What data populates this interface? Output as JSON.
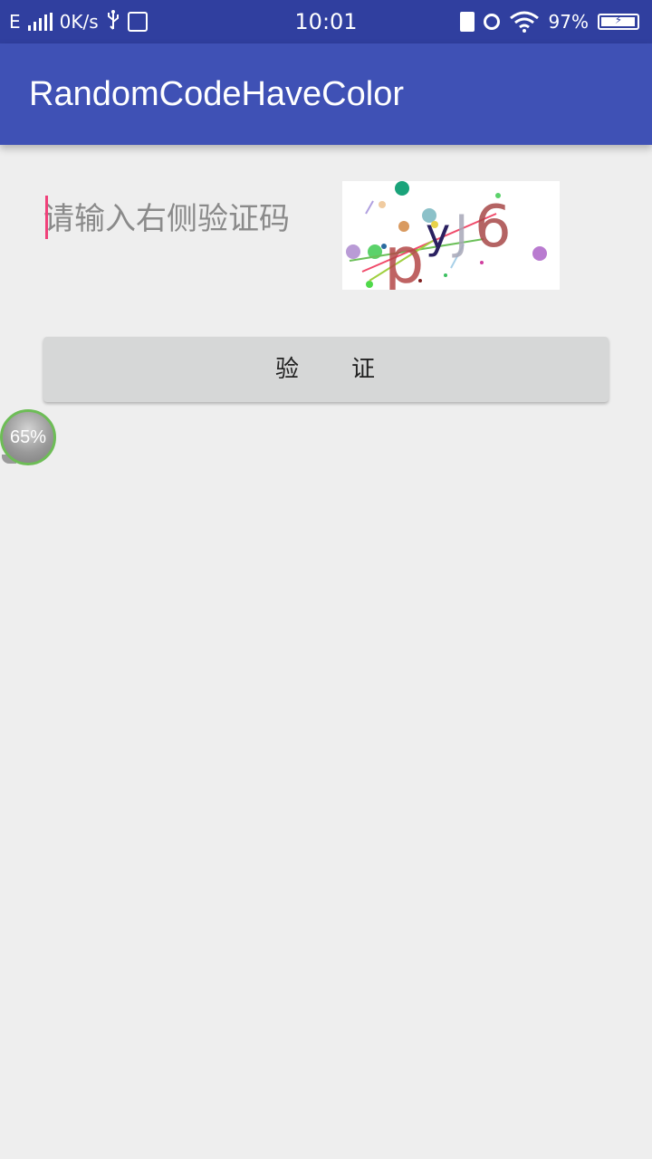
{
  "status_bar": {
    "network_type": "E",
    "speed": "0K/s",
    "time": "10:01",
    "battery_percent": "97%",
    "battery_level": 0.97,
    "icons": [
      "signal-icon",
      "usb-icon",
      "debug-icon",
      "charging-icon",
      "alarm-icon",
      "wifi-icon",
      "battery-icon"
    ]
  },
  "app_bar": {
    "title": "RandomCodeHaveColor"
  },
  "form": {
    "code_placeholder": "请输入右侧验证码",
    "code_value": "",
    "captcha_text": "pyJ6",
    "verify_label": "验　　证"
  },
  "floating_widget": {
    "label": "65%",
    "accent": "#6dbd56"
  },
  "colors": {
    "status_bar": "#303f9f",
    "app_bar": "#3f51b5",
    "background": "#eeeeee",
    "cursor": "#f0417a",
    "button": "#d6d7d7"
  }
}
